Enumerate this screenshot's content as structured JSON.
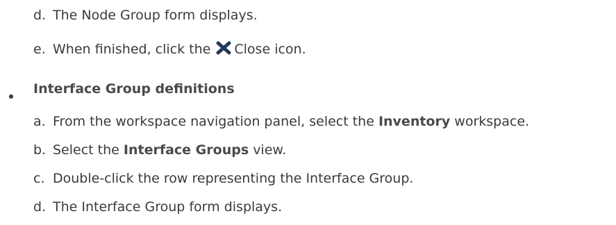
{
  "previous_steps": [
    {
      "marker": "d.",
      "text": "The Node Group form displays."
    },
    {
      "marker": "e.",
      "before": "When finished, click the",
      "icon": "close-icon",
      "after": "Close icon."
    }
  ],
  "section": {
    "title": "Interface Group definitions",
    "steps": [
      {
        "marker": "a.",
        "before": "From the workspace navigation panel, select the",
        "bold": "Inventory",
        "after": "workspace."
      },
      {
        "marker": "b.",
        "before": "Select the",
        "bold": "Interface Groups",
        "after": "view."
      },
      {
        "marker": "c.",
        "text": "Double-click the row representing the Interface Group."
      },
      {
        "marker": "d.",
        "text": "The Interface Group form displays."
      }
    ]
  }
}
